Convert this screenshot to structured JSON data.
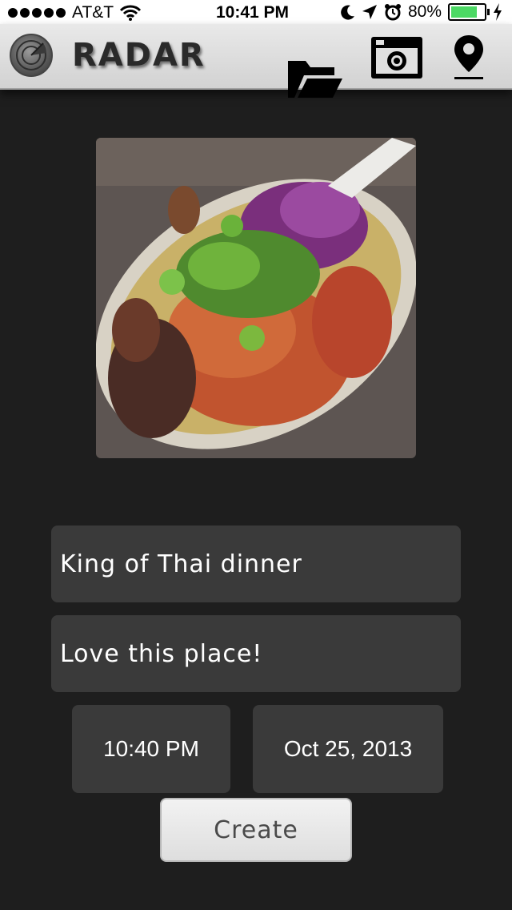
{
  "status_bar": {
    "carrier": "AT&T",
    "time": "10:41 PM",
    "battery_percent": "80%",
    "battery_level": 0.8,
    "icons": [
      "signal-dots-icon",
      "wifi-icon",
      "moon-icon",
      "location-arrow-icon",
      "alarm-icon",
      "battery-icon",
      "charging-bolt-icon"
    ]
  },
  "nav": {
    "title": "RADAR",
    "icons": [
      "radar-logo-icon",
      "folder-open-icon",
      "camera-icon",
      "map-pin-icon"
    ]
  },
  "photo": {
    "description_icon": "food-photo"
  },
  "form": {
    "title_value": "King of Thai dinner",
    "note_value": "Love this place!",
    "time_value": "10:40 PM",
    "date_value": "Oct 25, 2013",
    "create_label": "Create"
  },
  "colors": {
    "background": "#1e1e1e",
    "field": "#3a3a3a",
    "battery_green": "#4cd964"
  }
}
